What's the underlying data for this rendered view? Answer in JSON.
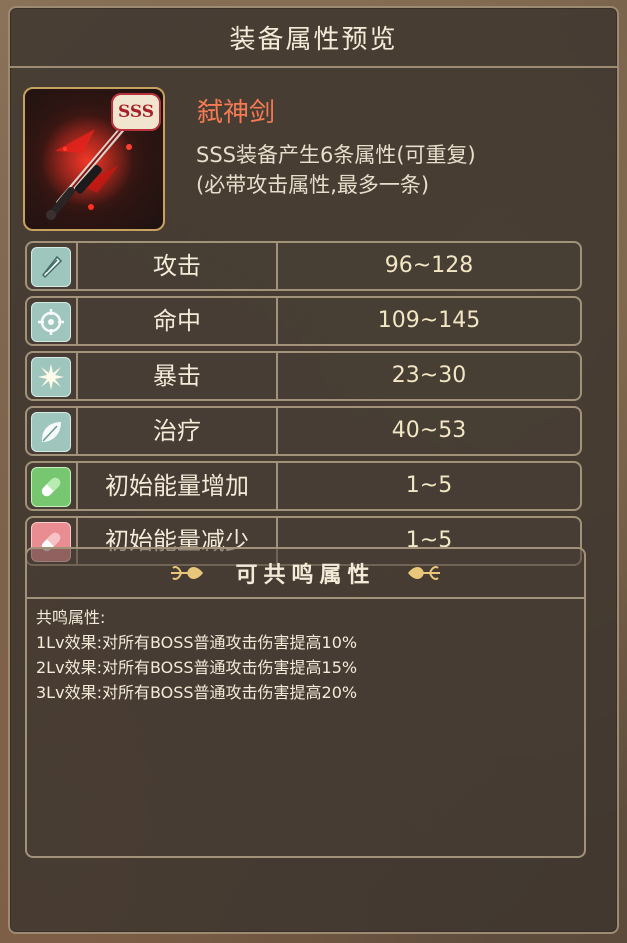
{
  "window": {
    "title": "装备属性预览"
  },
  "item": {
    "name": "弑神剑",
    "rank": "SSS",
    "description_lines": [
      "SSS装备产生6条属性(可重复)",
      "(必带攻击属性,最多一条)"
    ],
    "icon": "crimson-sword-icon"
  },
  "stats": [
    {
      "name": "攻击",
      "value": "96~128",
      "icon": "sword-nib-icon",
      "color": "#9fc6bd"
    },
    {
      "name": "命中",
      "value": "109~145",
      "icon": "crosshair-icon",
      "color": "#9fc6bd"
    },
    {
      "name": "暴击",
      "value": "23~30",
      "icon": "burst-icon",
      "color": "#9fc6bd"
    },
    {
      "name": "治疗",
      "value": "40~53",
      "icon": "leaf-icon",
      "color": "#9fc6bd"
    },
    {
      "name": "初始能量增加",
      "value": "1~5",
      "icon": "pill-icon",
      "color": "#77c770"
    },
    {
      "name": "初始能量减少",
      "value": "1~5",
      "icon": "pill-icon",
      "color": "#e98d92"
    }
  ],
  "resonance": {
    "title": "可共鸣属性",
    "lines": [
      "共鸣属性:",
      "1Lv效果:对所有BOSS普通攻击伤害提高10%",
      "2Lv效果:对所有BOSS普通攻击伤害提高15%",
      "3Lv效果:对所有BOSS普通攻击伤害提高20%"
    ]
  },
  "colors": {
    "item_name": "#f47a54",
    "rank_badge": "#a6202a",
    "border": "#a3927a"
  }
}
